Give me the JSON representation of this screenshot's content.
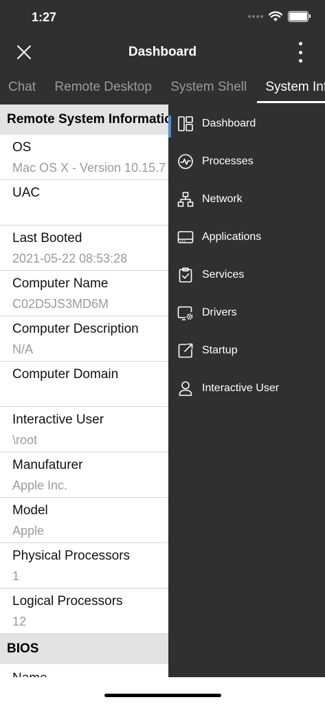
{
  "status_bar": {
    "time": "1:27"
  },
  "header": {
    "title": "Dashboard"
  },
  "tabs": [
    {
      "label": "Chat"
    },
    {
      "label": "Remote Desktop"
    },
    {
      "label": "System Shell"
    },
    {
      "label": "System Information"
    }
  ],
  "remote_info": {
    "section_title": "Remote System Information",
    "rows": [
      {
        "label": "OS",
        "value": "Mac OS X - Version 10.15.7"
      },
      {
        "label": "UAC",
        "value": ""
      },
      {
        "label": "Last Booted",
        "value": "2021-05-22 08:53:28"
      },
      {
        "label": "Computer Name",
        "value": "C02D5JS3MD6M"
      },
      {
        "label": "Computer Description",
        "value": "N/A"
      },
      {
        "label": "Computer Domain",
        "value": ""
      },
      {
        "label": "Interactive User",
        "value": "\\root"
      },
      {
        "label": "Manufaturer",
        "value": "Apple Inc."
      },
      {
        "label": "Model",
        "value": "Apple"
      },
      {
        "label": "Physical Processors",
        "value": "1"
      },
      {
        "label": "Logical Processors",
        "value": "12"
      }
    ]
  },
  "bios": {
    "section_title": "BIOS",
    "partial_label": "Name"
  },
  "drawer": {
    "items": [
      {
        "label": "Dashboard",
        "icon": "dashboard-icon"
      },
      {
        "label": "Processes",
        "icon": "processes-icon"
      },
      {
        "label": "Network",
        "icon": "network-icon"
      },
      {
        "label": "Applications",
        "icon": "applications-icon"
      },
      {
        "label": "Services",
        "icon": "services-icon"
      },
      {
        "label": "Drivers",
        "icon": "drivers-icon"
      },
      {
        "label": "Startup",
        "icon": "startup-icon"
      },
      {
        "label": "Interactive User",
        "icon": "interactive-user-icon"
      }
    ]
  },
  "colors": {
    "background": "#303030",
    "accent": "#4a8fd8",
    "value_text": "#9b9b9b"
  }
}
